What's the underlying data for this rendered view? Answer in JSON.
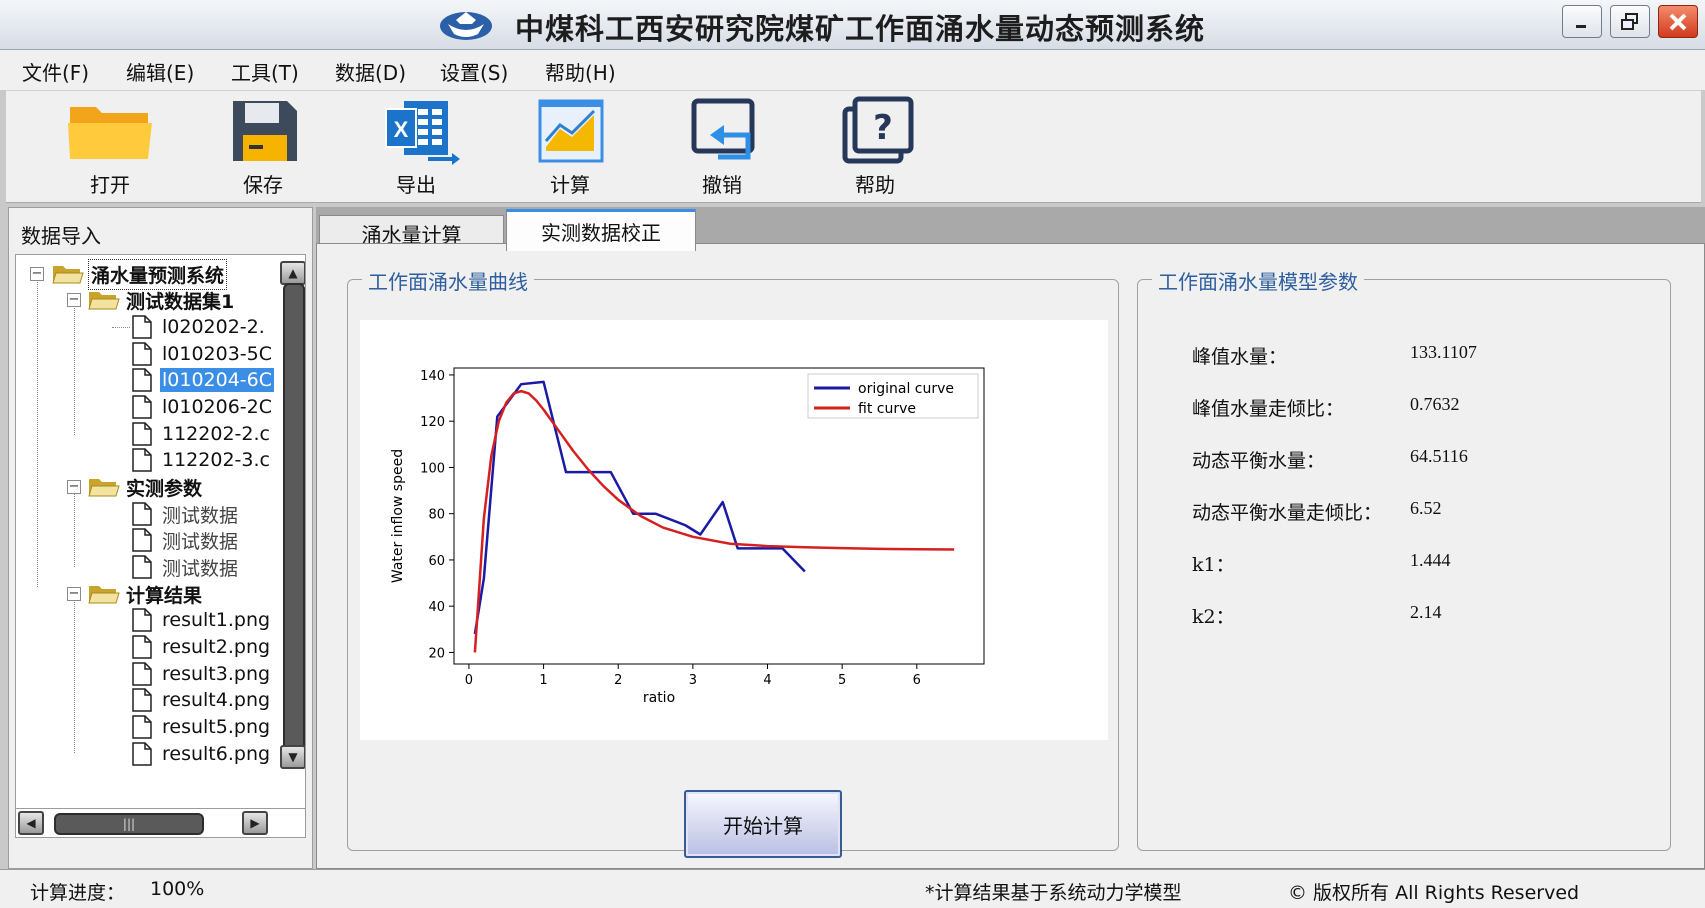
{
  "window": {
    "title": "中煤科工西安研究院煤矿工作面涌水量动态预测系统",
    "logo_icon": "ship-logo-icon",
    "controls": [
      "minimize-icon",
      "restore-icon",
      "close-icon"
    ]
  },
  "menu": {
    "items": [
      "文件(F)",
      "编辑(E)",
      "工具(T)",
      "数据(D)",
      "设置(S)",
      "帮助(H)"
    ]
  },
  "toolbar": {
    "items": [
      {
        "label": "打开",
        "icon": "folder-icon"
      },
      {
        "label": "保存",
        "icon": "save-disk-icon"
      },
      {
        "label": "导出",
        "icon": "excel-export-icon"
      },
      {
        "label": "计算",
        "icon": "chart-calc-icon"
      },
      {
        "label": "撤销",
        "icon": "undo-icon"
      },
      {
        "label": "帮助",
        "icon": "help-icon"
      }
    ]
  },
  "left_panel": {
    "title": "数据导入",
    "tree": {
      "root": "涌水量预测系统",
      "groups": [
        {
          "label": "测试数据集1",
          "children": [
            "l020202-2.",
            "l010203-5C",
            "l010204-6C",
            "l010206-2C",
            "112202-2.c",
            "112202-3.c"
          ],
          "selected": "l010204-6C"
        },
        {
          "label": "实测参数",
          "children": [
            "测试数据",
            "测试数据",
            "测试数据"
          ]
        },
        {
          "label": "计算结果",
          "children": [
            "result1.png",
            "result2.png",
            "result3.png",
            "result4.png",
            "result5.png",
            "result6.png"
          ]
        }
      ]
    }
  },
  "tabs": {
    "calc": "涌水量计算",
    "verify": "实测数据校正",
    "active": "verify"
  },
  "curve_group": {
    "title": "工作面涌水量曲线",
    "start_button": "开始计算"
  },
  "chart_data": {
    "type": "line",
    "title": "",
    "xlabel": "ratio",
    "ylabel": "Water inflow speed",
    "xlim": [
      -0.2,
      6.9
    ],
    "ylim": [
      15,
      143
    ],
    "xticks": [
      0,
      1,
      2,
      3,
      4,
      5,
      6
    ],
    "yticks": [
      20,
      40,
      60,
      80,
      100,
      120,
      140
    ],
    "legend_position": "top-right",
    "grid": false,
    "series": [
      {
        "name": "original curve",
        "color": "#1a1aa6",
        "x": [
          0.08,
          0.2,
          0.38,
          0.7,
          1.0,
          1.3,
          1.5,
          1.9,
          2.2,
          2.5,
          2.9,
          3.1,
          3.4,
          3.6,
          4.2,
          4.5
        ],
        "y": [
          28,
          52,
          122,
          136,
          137,
          98,
          98,
          98,
          80,
          80,
          75,
          71,
          85,
          65,
          65,
          55
        ]
      },
      {
        "name": "fit curve",
        "color": "#d62020",
        "x": [
          0.08,
          0.2,
          0.3,
          0.4,
          0.5,
          0.6,
          0.7,
          0.8,
          0.9,
          1.0,
          1.2,
          1.4,
          1.6,
          1.8,
          2.0,
          2.3,
          2.6,
          3.0,
          3.5,
          4.0,
          4.5,
          5.0,
          5.5,
          6.0,
          6.5
        ],
        "y": [
          20,
          78,
          105,
          120,
          128,
          132,
          133,
          132,
          129,
          125,
          116,
          107,
          99,
          92,
          86,
          79,
          74,
          70,
          67,
          66,
          65.5,
          65.1,
          64.8,
          64.6,
          64.5
        ]
      }
    ]
  },
  "params_group": {
    "title": "工作面涌水量模型参数",
    "rows": [
      {
        "label": "峰值水量：",
        "value": "133.1107"
      },
      {
        "label": "峰值水量走倾比：",
        "value": "0.7632"
      },
      {
        "label": "动态平衡水量：",
        "value": "64.5116"
      },
      {
        "label": "动态平衡水量走倾比：",
        "value": "6.52"
      },
      {
        "label": "k1：",
        "value": "1.444"
      },
      {
        "label": "k2：",
        "value": "2.14"
      }
    ]
  },
  "status_bar": {
    "progress_label": "计算进度：",
    "progress_value": "100%",
    "note": "*计算结果基于系统动力学模型",
    "copyright": "© 版权所有  All Rights Reserved"
  }
}
